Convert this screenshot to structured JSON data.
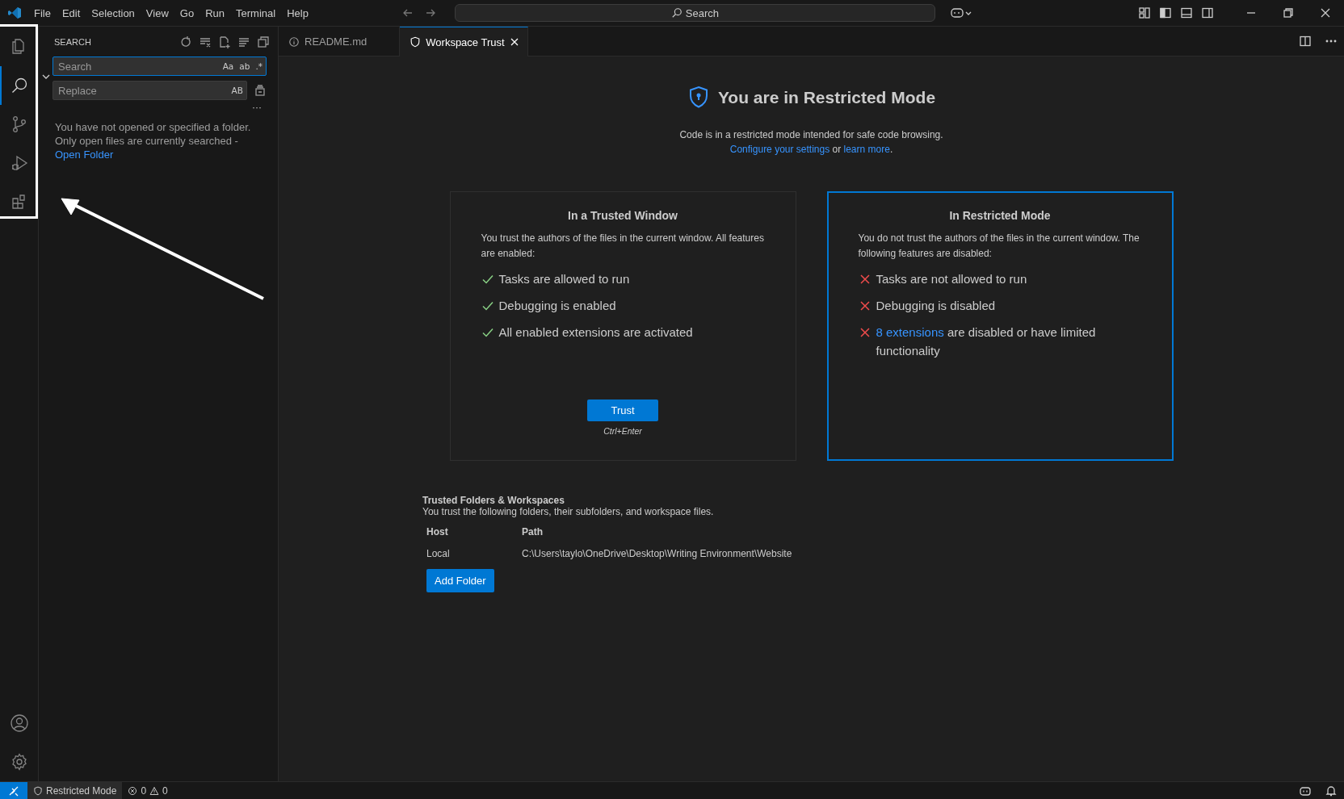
{
  "menu_bar": {
    "items": [
      "File",
      "Edit",
      "Selection",
      "View",
      "Go",
      "Run",
      "Terminal",
      "Help"
    ]
  },
  "command_center": {
    "placeholder": "Search"
  },
  "activity_bar": {
    "items": [
      {
        "kind": "files",
        "selected": false
      },
      {
        "kind": "search",
        "selected": true
      },
      {
        "kind": "source-control",
        "selected": false
      },
      {
        "kind": "run-debug",
        "selected": false
      },
      {
        "kind": "extensions",
        "selected": false
      }
    ],
    "bottom": [
      {
        "kind": "accounts"
      },
      {
        "kind": "manage"
      }
    ]
  },
  "sidebar": {
    "title": "SEARCH",
    "search_field": {
      "placeholder": "Search",
      "toggles": [
        "Aa",
        "ab",
        ".*"
      ]
    },
    "replace_field": {
      "placeholder": "Replace",
      "toggles": [
        "AB"
      ]
    },
    "more": "···",
    "message": "You have not opened or specified a folder. Only open files are currently searched -",
    "link": "Open Folder"
  },
  "tabs": [
    {
      "label": "README.md",
      "kind": "info",
      "selected": false
    },
    {
      "label": "Workspace Trust",
      "kind": "shield",
      "selected": true
    }
  ],
  "trust_page": {
    "title": "You are in Restricted Mode",
    "description": "Code is in a restricted mode intended for safe code browsing.",
    "settings_link": "Configure your settings",
    "joiner": "or",
    "learn_link": "learn more",
    "end": ".",
    "cards": [
      {
        "title": "In a Trusted Window",
        "description": "You trust the authors of the files in the current window. All features are enabled:",
        "selected": false,
        "features": [
          {
            "text": "Tasks are allowed to run",
            "allowed": true
          },
          {
            "text": "Debugging is enabled",
            "allowed": true
          },
          {
            "text": "All enabled extensions are activated",
            "allowed": true
          }
        ],
        "button": "Trust",
        "shortcut": "Ctrl+Enter"
      },
      {
        "title": "In Restricted Mode",
        "description": "You do not trust the authors of the files in the current window. The following features are disabled:",
        "selected": true,
        "features": [
          {
            "text": "Tasks are not allowed to run",
            "allowed": false
          },
          {
            "text": "Debugging is disabled",
            "allowed": false
          },
          {
            "link": "8 extensions",
            "text": "are disabled or have limited functionality",
            "allowed": false
          }
        ]
      }
    ],
    "trusted_folders": {
      "title": "Trusted Folders & Workspaces",
      "description": "You trust the following folders, their subfolders, and workspace files.",
      "columns": [
        "Host",
        "Path"
      ],
      "rows": [
        {
          "host": "Local",
          "path": "C:\\Users\\taylo\\OneDrive\\Desktop\\Writing Environment\\Website"
        }
      ],
      "button": "Add Folder"
    }
  },
  "status_bar": {
    "items": [
      {
        "kind": "remote"
      },
      {
        "kind": "mode",
        "label": "Restricted Mode"
      },
      {
        "kind": "problems",
        "errors": "0",
        "warnings": "0"
      }
    ]
  },
  "annotations": {
    "box": true,
    "arrow": true
  }
}
